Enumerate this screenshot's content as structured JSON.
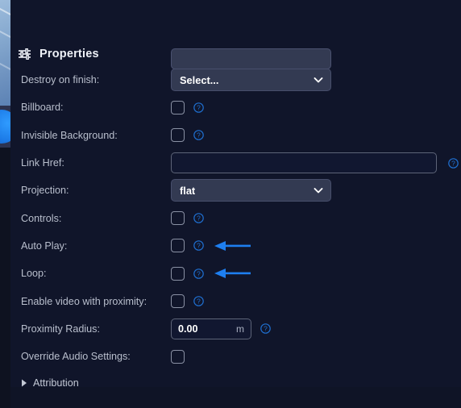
{
  "panel": {
    "title": "Properties",
    "icon": "sliders-icon"
  },
  "rows": [
    {
      "label": "Destroy on finish:",
      "control": "select",
      "value": "Select...",
      "help": false,
      "arrow": false
    },
    {
      "label": "Billboard:",
      "control": "checkbox",
      "value": "",
      "checked": false,
      "help": true,
      "arrow": false
    },
    {
      "label": "Invisible Background:",
      "control": "checkbox",
      "value": "",
      "checked": false,
      "help": true,
      "arrow": false
    },
    {
      "label": "Link Href:",
      "control": "text",
      "value": "",
      "placeholder": "",
      "help": true,
      "arrow": false
    },
    {
      "label": "Projection:",
      "control": "select",
      "value": "flat",
      "help": false,
      "arrow": false
    },
    {
      "label": "Controls:",
      "control": "checkbox",
      "value": "",
      "checked": false,
      "help": true,
      "arrow": false
    },
    {
      "label": "Auto Play:",
      "control": "checkbox",
      "value": "",
      "checked": false,
      "help": true,
      "arrow": true
    },
    {
      "label": "Loop:",
      "control": "checkbox",
      "value": "",
      "checked": false,
      "help": true,
      "arrow": true
    },
    {
      "label": "Enable video with proximity:",
      "control": "checkbox",
      "value": "",
      "checked": false,
      "help": true,
      "arrow": false
    },
    {
      "label": "Proximity Radius:",
      "control": "number",
      "value": "0.00",
      "unit": "m",
      "help": true,
      "arrow": false
    },
    {
      "label": "Override Audio Settings:",
      "control": "checkbox",
      "value": "",
      "checked": false,
      "help": false,
      "arrow": false
    }
  ],
  "attribution": {
    "label": "Attribution",
    "expanded": false
  },
  "colors": {
    "panel_background": "#10152a",
    "page_background": "#0e1220",
    "select_background": "#333a52",
    "label_text": "#b9bfcd",
    "accent_blue": "#1e7ff0",
    "help_blue": "#1f6fd0",
    "checkbox_border": "#8a91a4"
  }
}
